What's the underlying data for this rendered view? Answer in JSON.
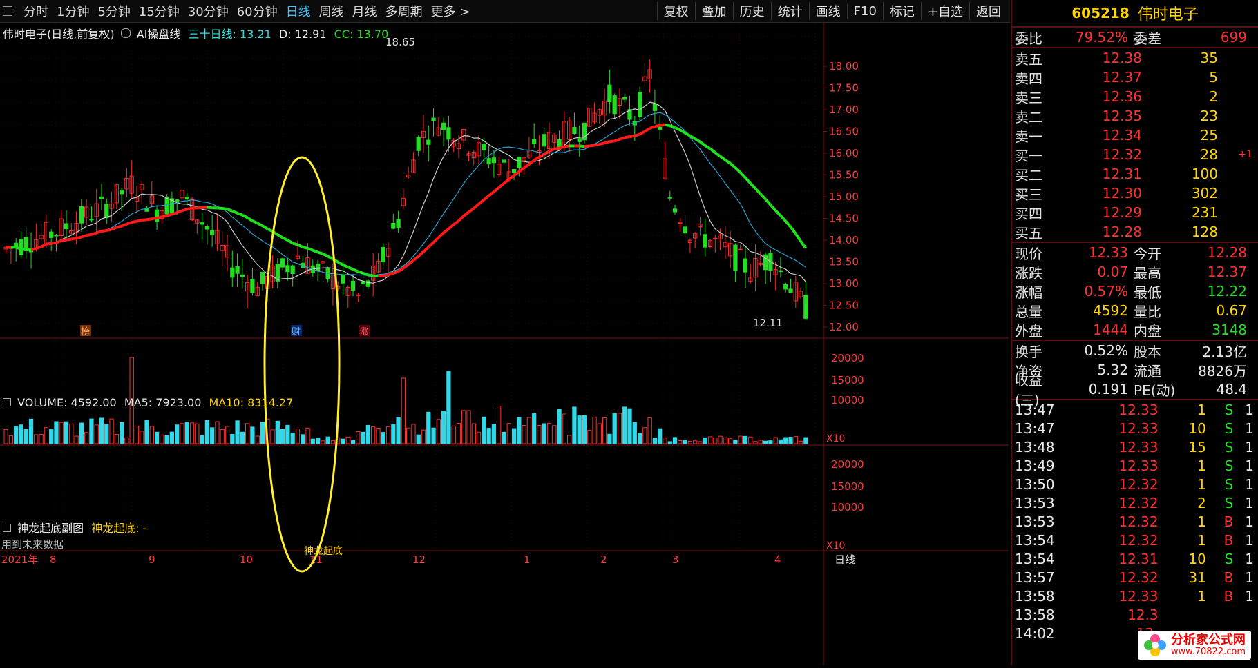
{
  "toolbar": {
    "tabs": [
      "分时",
      "1分钟",
      "5分钟",
      "15分钟",
      "30分钟",
      "60分钟",
      "日线",
      "周线",
      "月线",
      "多周期",
      "更多 >"
    ],
    "active_tab": "日线",
    "tools": [
      "复权",
      "叠加",
      "历史",
      "统计",
      "画线",
      "F10",
      "标记",
      "+自选",
      "返回"
    ]
  },
  "indicator": {
    "title": "伟时电子(日线,前复权)",
    "name": "AI操盘线",
    "ma30": "三十日线: 13.21",
    "d": "D: 12.91",
    "cc": "CC: 13.70"
  },
  "price_axis": [
    "18.00",
    "17.50",
    "17.00",
    "16.50",
    "16.00",
    "15.50",
    "15.00",
    "14.50",
    "14.00",
    "13.50",
    "13.00",
    "12.50",
    "12.00"
  ],
  "annotations": {
    "high": "18.65",
    "low": "12.11",
    "marker_bang": "榜",
    "marker_cai": "财",
    "marker_zhang": "涨"
  },
  "volume": {
    "label": "VOLUME: 4592.00",
    "ma5": "MA5: 7923.00",
    "ma10": "MA10: 8314.27",
    "axis": [
      "20000",
      "15000",
      "10000"
    ],
    "unit": "X10"
  },
  "sub": {
    "title": "神龙起底副图",
    "value": "神龙起底: -",
    "axis": [
      "20000",
      "15000",
      "10000"
    ],
    "unit": "X10",
    "note": "用到未来数据",
    "signal": "神龙起底"
  },
  "date_axis": {
    "labels": [
      "2021年",
      "8",
      "9",
      "10",
      "11",
      "12",
      "1",
      "2",
      "3",
      "4"
    ],
    "period": "日线"
  },
  "quote": {
    "code": "605218",
    "name": "伟时电子",
    "weibi_label": "委比",
    "weibi": "79.52%",
    "weicha_label": "委差",
    "weicha": "699",
    "asks": [
      {
        "label": "卖五",
        "price": "12.38",
        "qty": "35"
      },
      {
        "label": "卖四",
        "price": "12.37",
        "qty": "5"
      },
      {
        "label": "卖三",
        "price": "12.36",
        "qty": "2"
      },
      {
        "label": "卖二",
        "price": "12.35",
        "qty": "23"
      },
      {
        "label": "卖一",
        "price": "12.34",
        "qty": "25"
      }
    ],
    "bids": [
      {
        "label": "买一",
        "price": "12.32",
        "qty": "28",
        "chg": "+1"
      },
      {
        "label": "买二",
        "price": "12.31",
        "qty": "100",
        "chg": ""
      },
      {
        "label": "买三",
        "price": "12.30",
        "qty": "302",
        "chg": ""
      },
      {
        "label": "买四",
        "price": "12.29",
        "qty": "231",
        "chg": ""
      },
      {
        "label": "买五",
        "price": "12.28",
        "qty": "128",
        "chg": ""
      }
    ],
    "stats": [
      {
        "l1": "现价",
        "v1": "12.33",
        "c1": "red",
        "l2": "今开",
        "v2": "12.28",
        "c2": "red"
      },
      {
        "l1": "涨跌",
        "v1": "0.07",
        "c1": "red",
        "l2": "最高",
        "v2": "12.37",
        "c2": "red"
      },
      {
        "l1": "涨幅",
        "v1": "0.57%",
        "c1": "red",
        "l2": "最低",
        "v2": "12.22",
        "c2": "green"
      },
      {
        "l1": "总量",
        "v1": "4592",
        "c1": "yellow",
        "l2": "量比",
        "v2": "0.67",
        "c2": "yellow"
      },
      {
        "l1": "外盘",
        "v1": "1444",
        "c1": "red",
        "l2": "内盘",
        "v2": "3148",
        "c2": "green"
      }
    ],
    "stats2": [
      {
        "l1": "换手",
        "v1": "0.52%",
        "c1": "white",
        "l2": "股本",
        "v2": "2.13亿",
        "c2": "white"
      },
      {
        "l1": "净资",
        "v1": "5.32",
        "c1": "white",
        "l2": "流通",
        "v2": "8826万",
        "c2": "white"
      },
      {
        "l1": "收益(三)",
        "v1": "0.191",
        "c1": "white",
        "l2": "PE(动)",
        "v2": "48.4",
        "c2": "white"
      }
    ],
    "ticks": [
      {
        "t": "13:47",
        "p": "12.33",
        "pc": "red",
        "v": "1",
        "d": "S",
        "dc": "green",
        "n": "1"
      },
      {
        "t": "13:47",
        "p": "12.33",
        "pc": "red",
        "v": "10",
        "d": "S",
        "dc": "green",
        "n": "1"
      },
      {
        "t": "13:48",
        "p": "12.33",
        "pc": "red",
        "v": "15",
        "d": "S",
        "dc": "green",
        "n": "1"
      },
      {
        "t": "13:49",
        "p": "12.33",
        "pc": "red",
        "v": "1",
        "d": "S",
        "dc": "green",
        "n": "1"
      },
      {
        "t": "13:50",
        "p": "12.32",
        "pc": "red",
        "v": "1",
        "d": "S",
        "dc": "green",
        "n": "1"
      },
      {
        "t": "13:53",
        "p": "12.32",
        "pc": "red",
        "v": "2",
        "d": "S",
        "dc": "green",
        "n": "1"
      },
      {
        "t": "13:53",
        "p": "12.32",
        "pc": "red",
        "v": "1",
        "d": "B",
        "dc": "red",
        "n": "1"
      },
      {
        "t": "13:54",
        "p": "12.32",
        "pc": "red",
        "v": "1",
        "d": "B",
        "dc": "red",
        "n": "1"
      },
      {
        "t": "13:54",
        "p": "12.31",
        "pc": "red",
        "v": "10",
        "d": "S",
        "dc": "green",
        "n": "1"
      },
      {
        "t": "13:57",
        "p": "12.32",
        "pc": "red",
        "v": "31",
        "d": "B",
        "dc": "red",
        "n": "1"
      },
      {
        "t": "13:58",
        "p": "12.33",
        "pc": "red",
        "v": "1",
        "d": "B",
        "dc": "red",
        "n": "1"
      },
      {
        "t": "13:58",
        "p": "12.3",
        "pc": "red",
        "v": "",
        "d": "",
        "dc": "red",
        "n": ""
      },
      {
        "t": "14:02",
        "p": "12.",
        "pc": "red",
        "v": "",
        "d": "",
        "dc": "red",
        "n": ""
      }
    ],
    "logo_text": "分析家公式网",
    "logo_url": "www.70822.com"
  }
}
